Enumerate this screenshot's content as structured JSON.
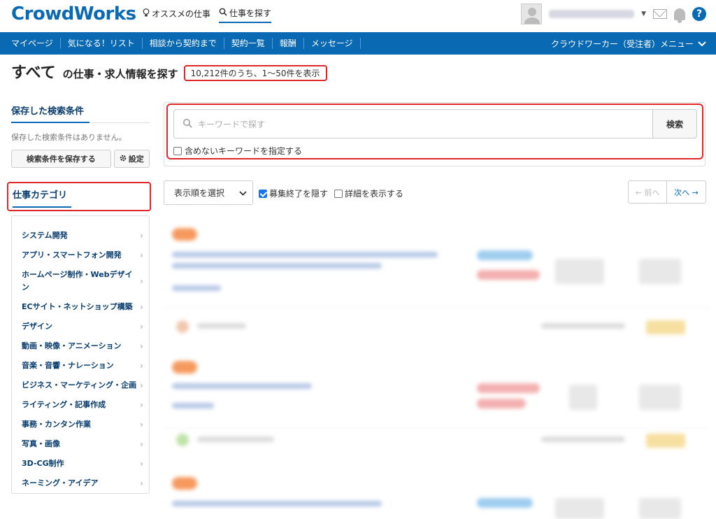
{
  "header": {
    "logo": "CrowdWorks",
    "nav": [
      {
        "label": "オススメの仕事",
        "icon": "lightbulb-icon",
        "active": false
      },
      {
        "label": "仕事を探す",
        "icon": "search-icon",
        "active": true
      }
    ],
    "icons": [
      "mail-icon",
      "bell-icon",
      "help-icon"
    ],
    "help_label": "?"
  },
  "bluenav": {
    "items": [
      "マイページ",
      "気になる！リスト",
      "相談から契約まで",
      "契約一覧",
      "報酬",
      "メッセージ"
    ],
    "menu_label": "クラウドワーカー（受注者）メニュー"
  },
  "title": {
    "big": "すべて",
    "rest": "の仕事・求人情報を探す",
    "count": "10,212件のうち、1～50件を表示"
  },
  "sidebar": {
    "saved_title": "保存した検索条件",
    "saved_empty": "保存した検索条件はありません。",
    "save_button": "検索条件を保存する",
    "setting_button": "設定",
    "category_title": "仕事カテゴリ",
    "categories": [
      "システム開発",
      "アプリ・スマートフォン開発",
      "ホームページ制作・Webデザイン",
      "ECサイト・ネットショップ構築",
      "デザイン",
      "動画・映像・アニメーション",
      "音楽・音響・ナレーション",
      "ビジネス・マーケティング・企画",
      "ライティング・記事作成",
      "事務・カンタン作業",
      "写真・画像",
      "3D-CG制作",
      "ネーミング・アイデア"
    ]
  },
  "search": {
    "placeholder": "キーワードで探す",
    "button": "検索",
    "exclude_label": "含めないキーワードを指定する"
  },
  "filters": {
    "sort_label": "表示順を選択",
    "hide_closed_label": "募集終了を隠す",
    "hide_closed_checked": true,
    "show_detail_label": "詳細を表示する",
    "show_detail_checked": false
  },
  "pager": {
    "prev": "← 前へ",
    "next": "次へ →"
  },
  "colors": {
    "brand": "#0a69b3",
    "highlight": "#e02828"
  }
}
